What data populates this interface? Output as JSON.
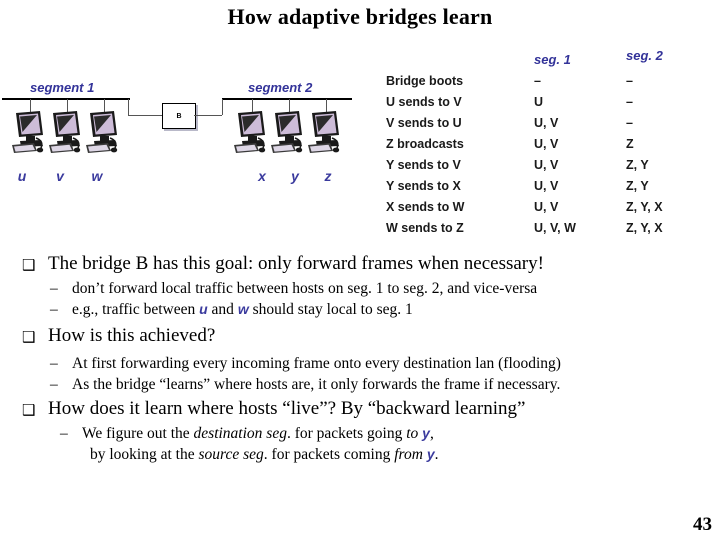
{
  "slide": {
    "title": "How adaptive bridges learn",
    "page_number": "43",
    "accent_blue": "#333399",
    "host_label_blue": "#3b3b9e"
  },
  "diagram": {
    "segment1_label": "segment 1",
    "segment2_label": "segment 2",
    "bridge_label": "B",
    "segment1_hosts": [
      "u",
      "v",
      "w"
    ],
    "segment2_hosts": [
      "x",
      "y",
      "z"
    ]
  },
  "trace_table": {
    "columns": [
      "",
      "seg. 1",
      "seg. 2"
    ],
    "rows": [
      {
        "event": "Bridge boots",
        "seg1": "–",
        "seg2": "–"
      },
      {
        "event": "U sends to V",
        "seg1": "U",
        "seg2": "–"
      },
      {
        "event": "V sends to U",
        "seg1": "U, V",
        "seg2": "–"
      },
      {
        "event": "Z broadcasts",
        "seg1": "U, V",
        "seg2": "Z"
      },
      {
        "event": "Y sends to V",
        "seg1": "U, V",
        "seg2": "Z, Y"
      },
      {
        "event": "Y sends to X",
        "seg1": "U, V",
        "seg2": "Z, Y"
      },
      {
        "event": "X sends to W",
        "seg1": "U, V",
        "seg2": "Z, Y, X"
      },
      {
        "event": "W sends to Z",
        "seg1": "U, V, W",
        "seg2": "Z, Y, X"
      }
    ]
  },
  "bullets": {
    "b1": "The bridge B has this goal: only forward frames when necessary!",
    "b1s1": "don’t forward local traffic between hosts on seg. 1 to seg. 2, and vice-versa",
    "b1s2_pre": "e.g., traffic between ",
    "b1s2_host1": "u",
    "b1s2_mid": " and ",
    "b1s2_host2": "w",
    "b1s2_post": " should stay local to seg. 1",
    "b2": "How is this achieved?",
    "b2s1": "At first forwarding every incoming frame onto every destination lan (flooding)",
    "b2s2": "As the bridge “learns” where hosts are, it only forwards the frame if necessary.",
    "b3": "How does it learn where hosts “live”?  By “backward learning”",
    "b3s1_pre": "We figure out the ",
    "b3s1_it1": "destination seg",
    "b3s1_mid": ". for packets going ",
    "b3s1_it2": "to",
    "b3s1_host": "y",
    "b3s1_post": ",",
    "b3s1_line2_pre": "by looking at the ",
    "b3s1_line2_it1": "source seg",
    "b3s1_line2_mid": ". for packets coming ",
    "b3s1_line2_it2": "from",
    "b3s1_line2_host": "y",
    "b3s1_line2_post": "."
  }
}
